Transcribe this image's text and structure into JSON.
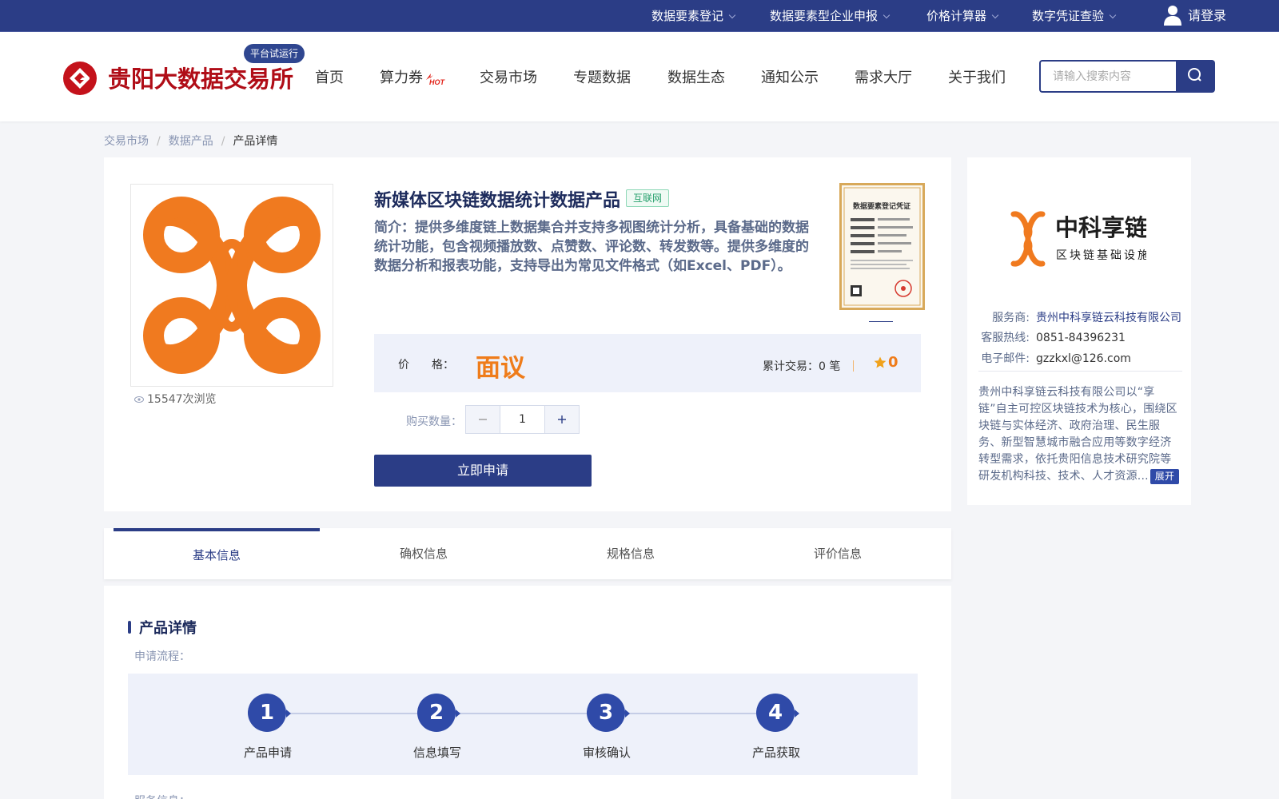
{
  "topbar": {
    "items": [
      {
        "label": "数据要素登记"
      },
      {
        "label": "数据要素型企业申报"
      },
      {
        "label": "价格计算器"
      },
      {
        "label": "数字凭证查验"
      }
    ],
    "login_label": "请登录"
  },
  "header": {
    "brand": "贵阳大数据交易所",
    "trial_badge": "平台试运行",
    "nav": [
      {
        "label": "首页"
      },
      {
        "label": "算力券"
      },
      {
        "label": "交易市场"
      },
      {
        "label": "专题数据"
      },
      {
        "label": "数据生态"
      },
      {
        "label": "通知公示"
      },
      {
        "label": "需求大厅"
      },
      {
        "label": "关于我们"
      }
    ],
    "hot_badge": "HOT",
    "search": {
      "placeholder": "请输入搜索内容",
      "value": ""
    }
  },
  "breadcrumb": [
    "交易市场",
    "数据产品",
    "产品详情"
  ],
  "product": {
    "title": "新媒体区块链数据统计数据产品",
    "tag": "互联网",
    "intro": "简介：提供多维度链上数据集合并支持多视图统计分析，具备基础的数据统计功能，包含视频播放数、点赞数、评论数、转发数等。提供多维度的数据分析和报表功能，支持导出为常见文件格式（如Excel、PDF）。",
    "views": "15547次浏览",
    "price_label": "价　　格：",
    "price_value": "面议",
    "trade_label": "累计交易：",
    "trade_count": "0",
    "trade_unit": "笔",
    "rating": "0",
    "qty_label": "购买数量：",
    "qty_value": "1",
    "apply_label": "立即申请",
    "cert_title": "数据要素登记凭证"
  },
  "tabs": [
    {
      "label": "基本信息",
      "active": true
    },
    {
      "label": "确权信息",
      "active": false
    },
    {
      "label": "规格信息",
      "active": false
    },
    {
      "label": "评价信息",
      "active": false
    }
  ],
  "detail": {
    "section_title": "产品详情",
    "flow_label": "申请流程：",
    "steps": [
      {
        "num": "1",
        "label": "产品申请"
      },
      {
        "num": "2",
        "label": "信息填写"
      },
      {
        "num": "3",
        "label": "审核确认"
      },
      {
        "num": "4",
        "label": "产品获取"
      }
    ],
    "service_label": "服务信息："
  },
  "provider": {
    "logo_text": "中科享链",
    "logo_sub": "区块链基础设施",
    "vendor_label": "服务商:",
    "vendor_value": "贵州中科享链云科技有限公司",
    "hotline_label": "客服热线:",
    "hotline_value": "0851-84396231",
    "email_label": "电子邮件:",
    "email_value": "gzzkxl@126.com",
    "description": "贵州中科享链云科技有限公司以“享链”自主可控区块链技术为核心，围绕区块链与实体经济、政府治理、民生服务、新型智慧城市融合应用等数字经济转型需求，依托贵阳信息技术研究院等研发机构科技、技术、人才资源...",
    "expand_label": "展开"
  },
  "colors": {
    "primary": "#2b3d86",
    "accent": "#ef7c1a",
    "brand_red": "#b00d17",
    "tag_green": "#27a06d"
  }
}
